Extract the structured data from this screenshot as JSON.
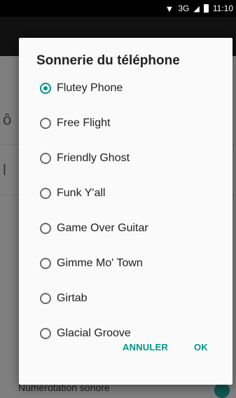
{
  "status_bar": {
    "network": "3G",
    "time": "11:10"
  },
  "background": {
    "footer_label": "Numérotation sonore"
  },
  "dialog": {
    "title": "Sonnerie du téléphone",
    "options": [
      {
        "label": "Flutey Phone",
        "selected": true
      },
      {
        "label": "Free Flight",
        "selected": false
      },
      {
        "label": "Friendly Ghost",
        "selected": false
      },
      {
        "label": "Funk Y'all",
        "selected": false
      },
      {
        "label": "Game Over Guitar",
        "selected": false
      },
      {
        "label": "Gimme Mo' Town",
        "selected": false
      },
      {
        "label": "Girtab",
        "selected": false
      },
      {
        "label": "Glacial Groove",
        "selected": false
      }
    ],
    "cancel_label": "ANNULER",
    "ok_label": "OK"
  },
  "colors": {
    "accent": "#009688",
    "scrim": "#7f7f7f"
  }
}
